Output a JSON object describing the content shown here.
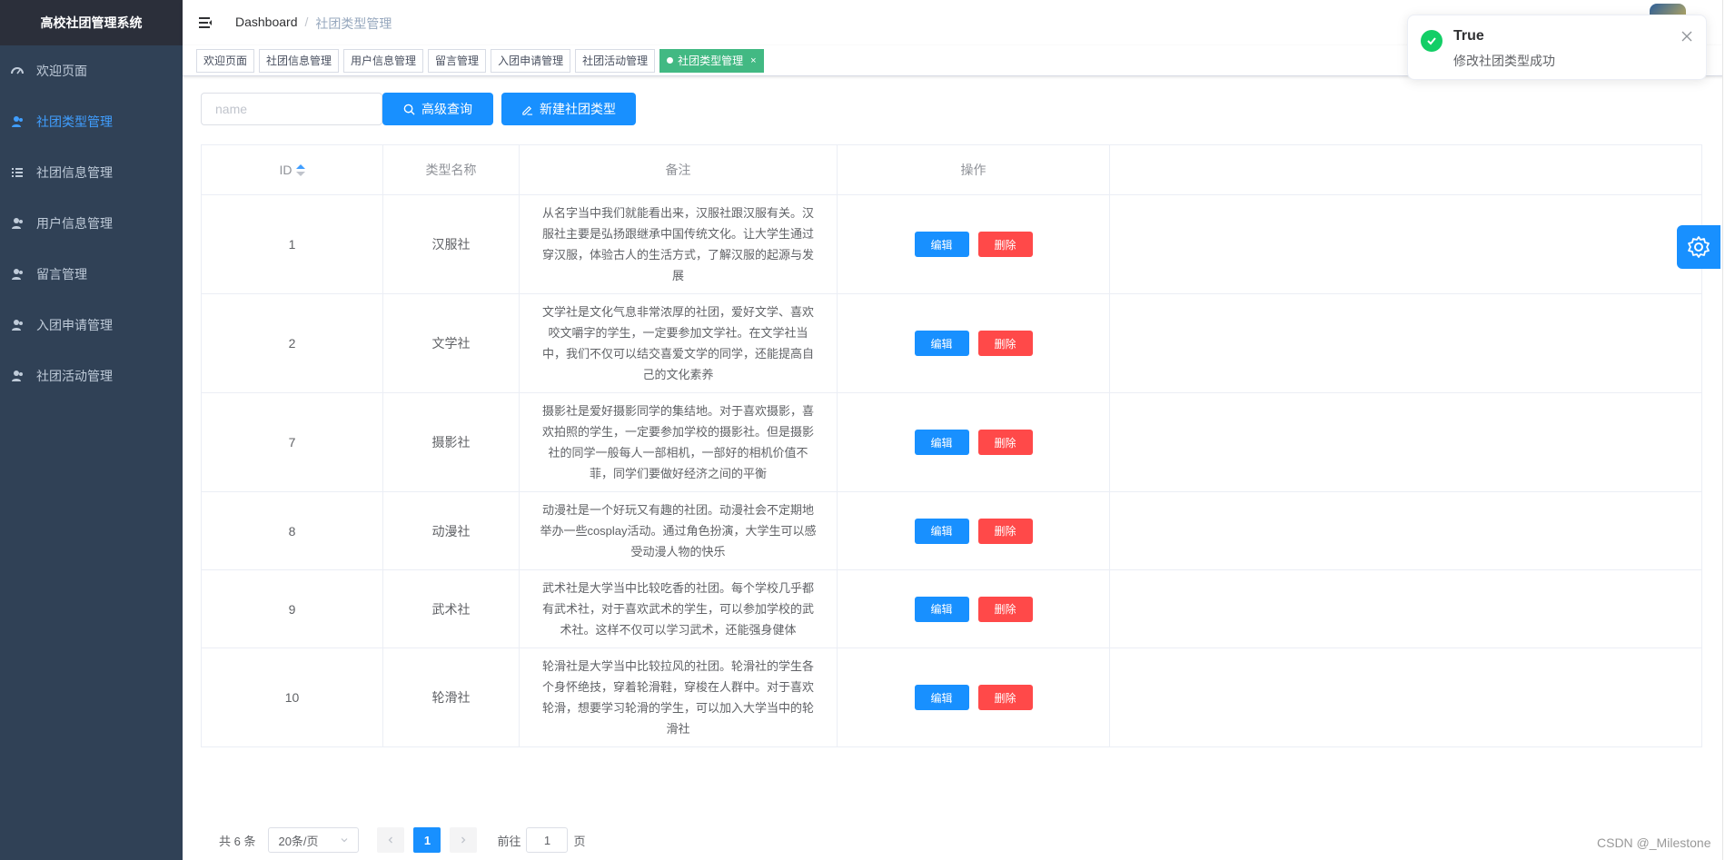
{
  "app": {
    "title": "高校社团管理系统"
  },
  "sidebar": {
    "items": [
      {
        "label": "欢迎页面",
        "icon": "dashboard-icon",
        "active": false
      },
      {
        "label": "社团类型管理",
        "icon": "user-icon",
        "active": true
      },
      {
        "label": "社团信息管理",
        "icon": "list-icon",
        "active": false
      },
      {
        "label": "用户信息管理",
        "icon": "user-icon",
        "active": false
      },
      {
        "label": "留言管理",
        "icon": "user-icon",
        "active": false
      },
      {
        "label": "入团申请管理",
        "icon": "user-icon",
        "active": false
      },
      {
        "label": "社团活动管理",
        "icon": "user-icon",
        "active": false
      }
    ]
  },
  "breadcrumb": {
    "home": "Dashboard",
    "separator": "/",
    "current": "社团类型管理"
  },
  "tags": [
    {
      "label": "欢迎页面",
      "active": false
    },
    {
      "label": "社团信息管理",
      "active": false
    },
    {
      "label": "用户信息管理",
      "active": false
    },
    {
      "label": "留言管理",
      "active": false
    },
    {
      "label": "入团申请管理",
      "active": false
    },
    {
      "label": "社团活动管理",
      "active": false
    },
    {
      "label": "社团类型管理",
      "active": true,
      "close": "×"
    }
  ],
  "search": {
    "placeholder": "name",
    "value": "",
    "search_label": "高级查询",
    "new_label": "新建社团类型"
  },
  "table": {
    "headers": {
      "id": "ID",
      "name": "类型名称",
      "remark": "备注",
      "ops": "操作"
    },
    "edit_label": "编辑",
    "delete_label": "删除",
    "rows": [
      {
        "id": "1",
        "name": "汉服社",
        "remark_lines": [
          "从名字当中我们就能看出来，汉服社跟汉服有关。汉",
          "服社主要是弘扬跟继承中国传统文化。让大学生通过",
          "穿汉服，体验古人的生活方式，了解汉服的起源与发",
          "展"
        ]
      },
      {
        "id": "2",
        "name": "文学社",
        "remark_lines": [
          "文学社是文化气息非常浓厚的社团，爱好文学、喜欢",
          "咬文嚼字的学生，一定要参加文学社。在文学社当",
          "中，我们不仅可以结交喜爱文学的同学，还能提高自",
          "己的文化素养"
        ]
      },
      {
        "id": "7",
        "name": "摄影社",
        "remark_lines": [
          "摄影社是爱好摄影同学的集结地。对于喜欢摄影，喜",
          "欢拍照的学生，一定要参加学校的摄影社。但是摄影",
          "社的同学一般每人一部相机，一部好的相机价值不",
          "菲，同学们要做好经济之间的平衡"
        ]
      },
      {
        "id": "8",
        "name": "动漫社",
        "remark_lines": [
          "动漫社是一个好玩又有趣的社团。动漫社会不定期地",
          "举办一些cosplay活动。通过角色扮演，大学生可以感",
          "受动漫人物的快乐"
        ]
      },
      {
        "id": "9",
        "name": "武术社",
        "remark_lines": [
          "武术社是大学当中比较吃香的社团。每个学校几乎都",
          "有武术社，对于喜欢武术的学生，可以参加学校的武",
          "术社。这样不仅可以学习武术，还能强身健体"
        ]
      },
      {
        "id": "10",
        "name": "轮滑社",
        "remark_lines": [
          "轮滑社是大学当中比较拉风的社团。轮滑社的学生各",
          "个身怀绝技，穿着轮滑鞋，穿梭在人群中。对于喜欢",
          "轮滑，想要学习轮滑的学生，可以加入大学当中的轮",
          "滑社"
        ]
      }
    ]
  },
  "pagination": {
    "total": "共 6 条",
    "page_size": "20条/页",
    "current_page": "1",
    "goto_prefix": "前往",
    "goto_value": "1",
    "goto_suffix": "页"
  },
  "notification": {
    "title": "True",
    "message": "修改社团类型成功"
  },
  "watermark": "CSDN @_Milestone",
  "colors": {
    "sidebar_bg": "#304156",
    "primary": "#1890ff",
    "danger": "#ff4949",
    "tag_active": "#42b983",
    "success": "#13ce66"
  }
}
